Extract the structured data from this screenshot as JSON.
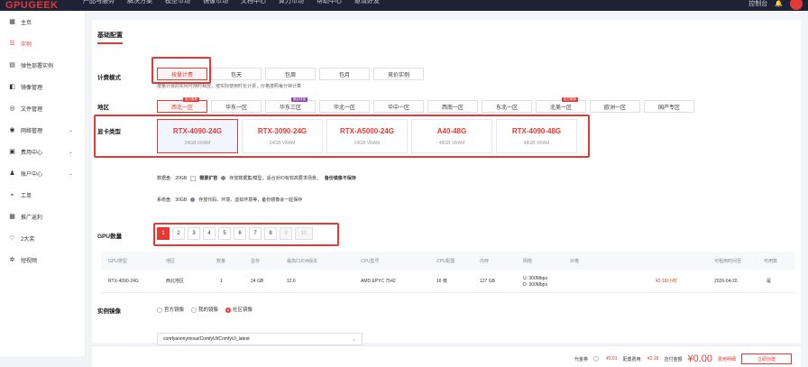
{
  "brand": {
    "name": "GPUGEEK",
    "accent": "#e53935"
  },
  "topnav": [
    "产品与服务",
    "解决方案",
    "模型市场",
    "镜像市场",
    "文档中心",
    "算力市场",
    "帮助中心",
    "邀请好友"
  ],
  "topright": {
    "link": "控制台"
  },
  "sidebar": {
    "items": [
      {
        "label": "主页",
        "icon": "home-icon"
      },
      {
        "label": "实例",
        "icon": "list-icon"
      },
      {
        "label": "弹性部署实例",
        "icon": "deploy-icon"
      },
      {
        "label": "镜像管理",
        "icon": "image-icon"
      },
      {
        "label": "文件管理",
        "icon": "file-icon"
      },
      {
        "label": "网络管理",
        "icon": "network-icon"
      },
      {
        "label": "费用中心",
        "icon": "billing-icon"
      },
      {
        "label": "账户中心",
        "icon": "user-icon"
      },
      {
        "label": "工单",
        "icon": "ticket-icon"
      },
      {
        "label": "推广返利",
        "icon": "promo-icon"
      },
      {
        "label": "2大奖",
        "icon": "gift-icon"
      },
      {
        "label": "短视频",
        "icon": "video-icon"
      }
    ]
  },
  "config": {
    "title": "基础配置",
    "billing": {
      "label": "计费模式",
      "options": [
        "按量计费",
        "包天",
        "包周",
        "包月",
        "竞价实例"
      ],
      "selected": 0,
      "hint": "按量计费的实例可随时释放，按实际使用时长计费，价格按照每分钟计算"
    },
    "region": {
      "label": "地区",
      "options": [
        "西北一区",
        "华东一区",
        "华东三区",
        "华北一区",
        "华中一区",
        "西南一区",
        "东北一区",
        "北美一区",
        "欧洲一区",
        "国产专区"
      ],
      "tags": {
        "0": "官方推荐",
        "2": "新区特惠",
        "7": "官方推荐"
      },
      "selected": 0
    },
    "gpu_type": {
      "label": "显卡类型",
      "cards": [
        {
          "name": "RTX-4090-24G",
          "mem": "24GB VRAM"
        },
        {
          "name": "RTX-3090-24G",
          "mem": "24GB VRAM"
        },
        {
          "name": "RTX-A5000-24G",
          "mem": "24GB VRAM"
        },
        {
          "name": "A40-48G",
          "mem": "48GB VRAM"
        },
        {
          "name": "RTX-4090-48G",
          "mem": "48GB VRAM"
        }
      ],
      "selected": 0
    },
    "data_disk": {
      "label": "数据盘:",
      "value": "20GB",
      "expand_label": "需要扩容",
      "note": "存放数据集/模型，适合对IO有较高要求场景。",
      "note_bold": "备份镜像不保存"
    },
    "system_disk": {
      "label": "系统盘:",
      "value": "30GB",
      "note": "存放代码、环境、虚拟环境等，备份镜像会一起保存"
    },
    "gpu_count": {
      "label": "GPU数量",
      "options": [
        "1",
        "2",
        "3",
        "4",
        "5",
        "6",
        "7",
        "8",
        "9",
        "10"
      ],
      "selected": 0,
      "disabled_from": 8
    }
  },
  "table": {
    "headers": [
      "GPU类型",
      "地区",
      "数量",
      "显存",
      "最高CUDA版本",
      "CPU型号",
      "CPU配置",
      "内存",
      "网络",
      "价格",
      "可租用时间至",
      "可用数"
    ],
    "rows": [
      [
        "RTX-4090-24G",
        "西北地区",
        "1",
        "24 GB",
        "12.6",
        "AMD EPYC 7542",
        "16 核",
        "127 GB",
        "U: 300Mbps",
        "¥2.18/小时",
        "2026-04-20",
        "是"
      ]
    ],
    "network_second": "D: 300Mbps"
  },
  "image": {
    "label": "实例镜像",
    "options": [
      "官方镜像",
      "我的镜像",
      "社区镜像"
    ],
    "selected": 2,
    "value": "comfyanonymous/ComfyUI/ComfyUI_latest"
  },
  "footer": {
    "coupon_label": "代金券",
    "coupon_value": "¥0.01",
    "price_label": "配置费用:",
    "price_value": "¥2.18",
    "total_label": "应付金额",
    "total_value": "¥0.00",
    "discount_label": "费用明细",
    "buy_label": "立即创建"
  }
}
